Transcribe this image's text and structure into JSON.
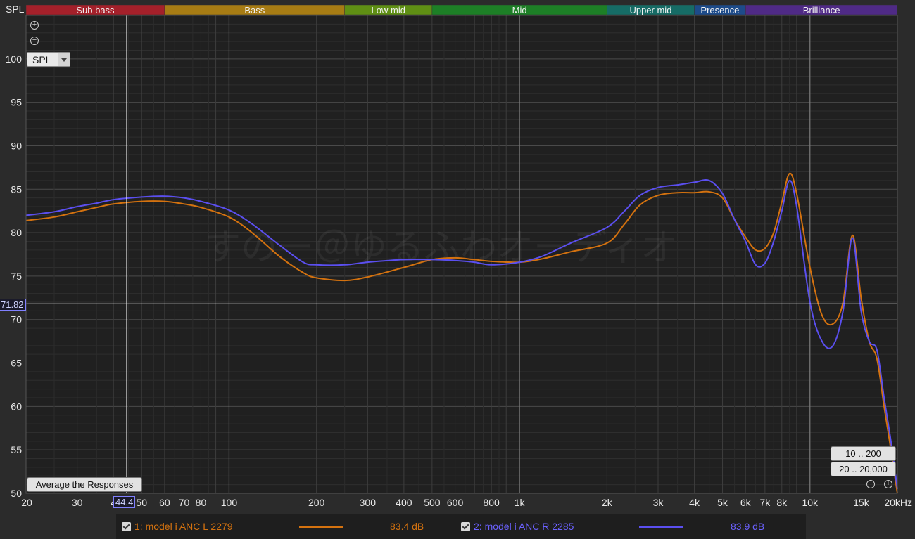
{
  "chart_data": {
    "type": "line",
    "ylabel": "SPL",
    "x_unit": "Hz",
    "x_scale": "log",
    "xlim": [
      20,
      20000
    ],
    "ylim": [
      50,
      105
    ],
    "y_ticks": [
      "50",
      "55",
      "60",
      "65",
      "70",
      "75",
      "80",
      "85",
      "90",
      "95",
      "100"
    ],
    "x_ticks": [
      {
        "value": 20,
        "label": "20"
      },
      {
        "value": 30,
        "label": "30"
      },
      {
        "value": 40,
        "label": "4"
      },
      {
        "value": 50,
        "label": "50"
      },
      {
        "value": 60,
        "label": "60"
      },
      {
        "value": 70,
        "label": "70"
      },
      {
        "value": 80,
        "label": "80"
      },
      {
        "value": 100,
        "label": "100"
      },
      {
        "value": 200,
        "label": "200"
      },
      {
        "value": 300,
        "label": "300"
      },
      {
        "value": 400,
        "label": "400"
      },
      {
        "value": 500,
        "label": "500"
      },
      {
        "value": 600,
        "label": "600"
      },
      {
        "value": 800,
        "label": "800"
      },
      {
        "value": 1000,
        "label": "1k"
      },
      {
        "value": 2000,
        "label": "2k"
      },
      {
        "value": 3000,
        "label": "3k"
      },
      {
        "value": 4000,
        "label": "4k"
      },
      {
        "value": 5000,
        "label": "5k"
      },
      {
        "value": 6000,
        "label": "6k"
      },
      {
        "value": 7000,
        "label": "7k"
      },
      {
        "value": 8000,
        "label": "8k"
      },
      {
        "value": 10000,
        "label": "10k"
      },
      {
        "value": 15000,
        "label": "15k"
      },
      {
        "value": 20000,
        "label": "20kHz"
      }
    ],
    "bands": [
      {
        "name": "Sub bass",
        "from": 20,
        "to": 60,
        "color": "#a4202a"
      },
      {
        "name": "Bass",
        "from": 60,
        "to": 250,
        "color": "#a77c14"
      },
      {
        "name": "Low mid",
        "from": 250,
        "to": 500,
        "color": "#5f8f14"
      },
      {
        "name": "Mid",
        "from": 500,
        "to": 2000,
        "color": "#1d7f26"
      },
      {
        "name": "Upper mid",
        "from": 2000,
        "to": 4000,
        "color": "#166c66"
      },
      {
        "name": "Presence",
        "from": 4000,
        "to": 6000,
        "color": "#1d4b8a"
      },
      {
        "name": "Brilliance",
        "from": 6000,
        "to": 20000,
        "color": "#4f2a86"
      }
    ],
    "cursor": {
      "x": 44.4,
      "y": 71.82,
      "x_label": "44.4",
      "y_label": "71.82"
    },
    "watermark": "すのー＠ゆるふわオーディオ",
    "series": [
      {
        "name": "1: model i ANC L 2279",
        "average": "83.4 dB",
        "color": "#d4720f",
        "x": [
          20,
          25,
          30,
          35,
          40,
          50,
          60,
          70,
          80,
          100,
          120,
          150,
          180,
          200,
          250,
          300,
          400,
          500,
          600,
          700,
          800,
          1000,
          1200,
          1500,
          2000,
          2300,
          2600,
          3000,
          3500,
          4000,
          4500,
          5000,
          5500,
          6000,
          6500,
          7000,
          7500,
          8000,
          8500,
          9000,
          10000,
          11000,
          12000,
          13000,
          14000,
          15000,
          16000,
          17000,
          18000,
          19000,
          20000
        ],
        "y": [
          81.4,
          81.8,
          82.4,
          82.9,
          83.3,
          83.6,
          83.6,
          83.3,
          82.9,
          81.8,
          80.0,
          77.2,
          75.4,
          74.8,
          74.5,
          74.9,
          76.0,
          76.9,
          77.1,
          76.9,
          76.7,
          76.6,
          77.0,
          77.8,
          78.8,
          81.0,
          83.2,
          84.3,
          84.6,
          84.6,
          84.7,
          84.0,
          81.5,
          79.5,
          78.0,
          78.2,
          80.0,
          83.5,
          86.8,
          84.5,
          76.0,
          70.5,
          69.5,
          72.0,
          79.7,
          72.5,
          67.5,
          65.5,
          60.0,
          55.0,
          50.0
        ]
      },
      {
        "name": "2: model i ANC R 2285",
        "average": "83.9 dB",
        "color": "#5b4ff0",
        "x": [
          20,
          25,
          30,
          35,
          40,
          50,
          60,
          70,
          80,
          100,
          120,
          150,
          180,
          200,
          250,
          300,
          400,
          500,
          600,
          700,
          800,
          1000,
          1200,
          1500,
          2000,
          2300,
          2600,
          3000,
          3500,
          4000,
          4500,
          5000,
          5500,
          6000,
          6500,
          7000,
          7500,
          8000,
          8500,
          9000,
          10000,
          11000,
          12000,
          13000,
          14000,
          15000,
          16000,
          17000,
          18000,
          19000,
          20000
        ],
        "y": [
          82.0,
          82.4,
          83.0,
          83.4,
          83.8,
          84.1,
          84.2,
          84.0,
          83.6,
          82.6,
          81.0,
          78.5,
          76.6,
          76.3,
          76.3,
          76.6,
          76.9,
          76.9,
          76.8,
          76.6,
          76.3,
          76.6,
          77.3,
          78.8,
          80.6,
          82.5,
          84.3,
          85.2,
          85.5,
          85.8,
          86.0,
          84.5,
          81.5,
          79.0,
          76.3,
          76.5,
          79.0,
          82.5,
          86.0,
          83.0,
          72.0,
          67.5,
          67.0,
          71.0,
          79.4,
          71.0,
          67.5,
          66.5,
          61.0,
          56.0,
          50.5
        ]
      }
    ]
  },
  "controls": {
    "spl_select": "SPL",
    "average_button": "Average the Responses",
    "range_button_1": "10 .. 200",
    "range_button_2": "20 .. 20,000",
    "zoom_in": "+",
    "zoom_out": "−"
  }
}
